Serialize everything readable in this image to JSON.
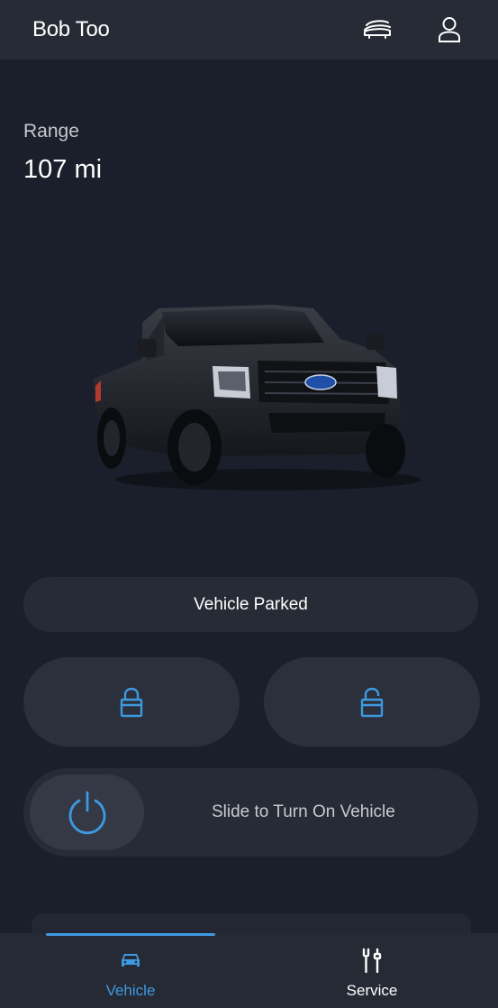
{
  "header": {
    "title": "Bob Too",
    "icons": [
      "vehicle-switch-icon",
      "account-icon"
    ]
  },
  "range": {
    "label": "Range",
    "value": "107  mi"
  },
  "vehicle_image": "pickup-truck",
  "status": {
    "text": "Vehicle Parked"
  },
  "controls": {
    "lock_icon": "lock-icon",
    "unlock_icon": "unlock-icon",
    "slider_label": "Slide to Turn On Vehicle",
    "slider_icon": "power-icon"
  },
  "nav": {
    "items": [
      {
        "label": "Vehicle",
        "icon": "car-icon",
        "active": true
      },
      {
        "label": "Service",
        "icon": "tools-icon",
        "active": false
      }
    ]
  },
  "colors": {
    "background": "#1b1f2b",
    "surface": "#272b36",
    "accent": "#3d9ae0"
  }
}
